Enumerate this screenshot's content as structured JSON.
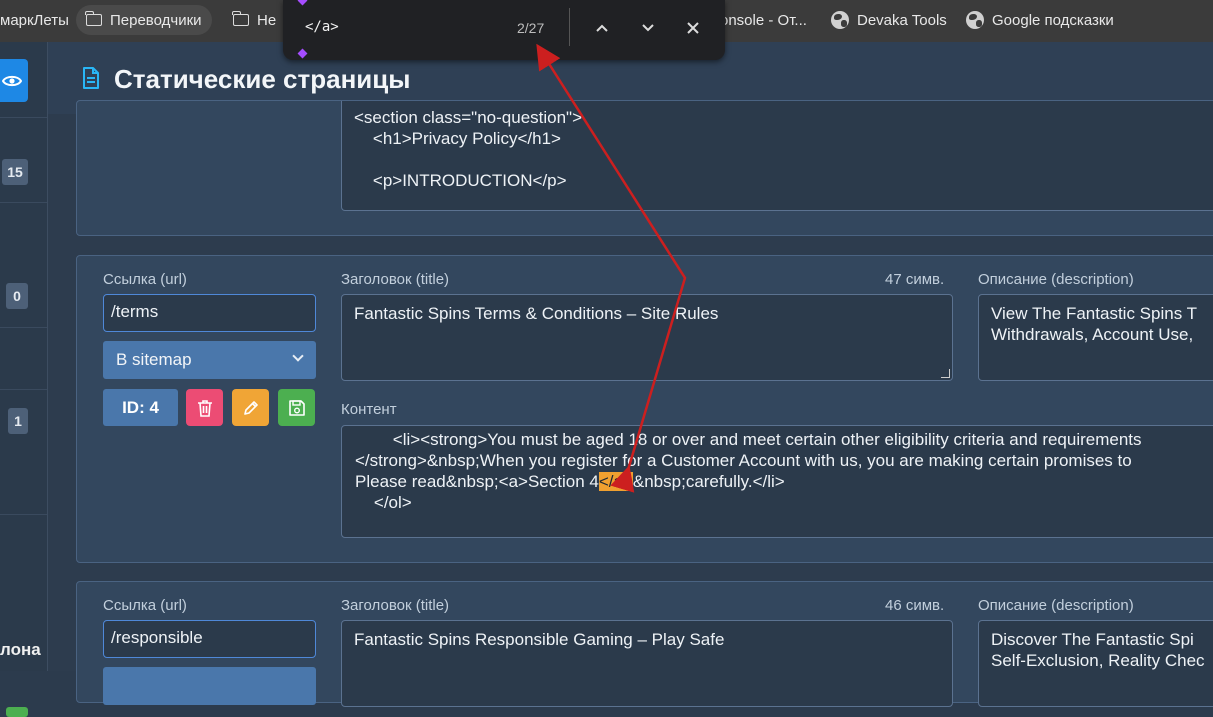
{
  "bookmarks": {
    "items": [
      {
        "label": "маркЛеты",
        "icon": "none"
      },
      {
        "label": "Переводчики",
        "icon": "folder-icon"
      },
      {
        "label": "Не",
        "icon": "folder-icon"
      },
      {
        "label": "onsole - От...",
        "icon": "none"
      },
      {
        "label": "Devaka Tools",
        "icon": "globe-icon"
      },
      {
        "label": "Google подсказки",
        "icon": "globe-icon"
      }
    ]
  },
  "find": {
    "query": "</a>",
    "count": "2/27"
  },
  "sidebar": {
    "badges": [
      "15",
      "0",
      "1"
    ],
    "label_fragment": "лона"
  },
  "page": {
    "title": "Статические страницы"
  },
  "card_top": {
    "content_lines": [
      "<section class=\"no-question\">",
      "    <h1>Privacy Policy</h1>",
      "",
      "    <p>INTRODUCTION</p>"
    ]
  },
  "card_terms": {
    "url_label": "Ссылка (url)",
    "url_value": "/terms",
    "sitemap": "В sitemap",
    "id_label": "ID: 4",
    "title_label": "Заголовок (title)",
    "title_count": "47 симв.",
    "title_value": "Fantastic Spins Terms & Conditions – Site Rules",
    "desc_label": "Описание (description)",
    "desc_value": "View The Fantastic Spins T Withdrawals, Account Use,",
    "content_label": "Контент",
    "content_line1": "        <li><strong>You must be aged 18 or over and meet certain other eligibility criteria and requirements",
    "content_line2": "</strong>&nbsp;When you register for a Customer Account with us, you are making certain promises to",
    "content_line3_pre": "Please read&nbsp;<a>Section 4",
    "content_line3_hl": "</a>",
    "content_line3_post": "&nbsp;carefully.</li>",
    "content_line4": "    </ol>"
  },
  "card_responsible": {
    "url_label": "Ссылка (url)",
    "url_value": "/responsible",
    "title_label": "Заголовок (title)",
    "title_count": "46 симв.",
    "title_value": "Fantastic Spins Responsible Gaming – Play Safe",
    "desc_label": "Описание (description)",
    "desc_value": "Discover The Fantastic Spi Self-Exclusion, Reality Chec"
  },
  "colors": {
    "accent": "#1e88e5",
    "delete": "#ec4c74",
    "edit": "#f0a536",
    "save": "#4caf50",
    "highlight": "#f0a030",
    "arrow": "#cc1f1f"
  }
}
